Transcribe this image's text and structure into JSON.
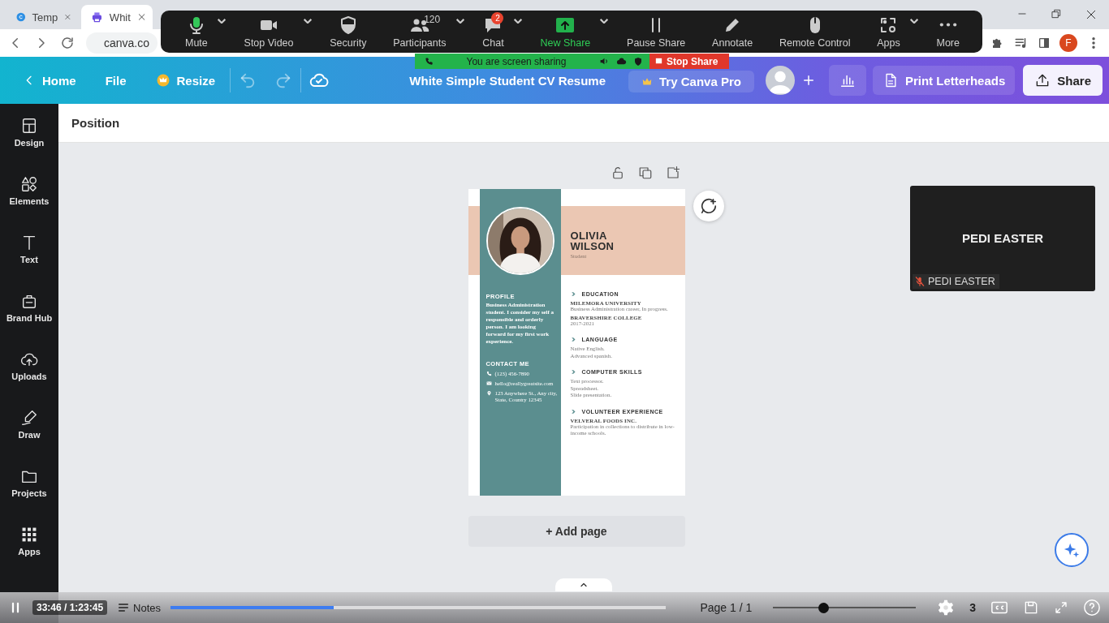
{
  "browser": {
    "tabs": [
      {
        "title": "Temp",
        "selected": false
      },
      {
        "title": "Whit",
        "selected": true
      }
    ],
    "address": "canva.co",
    "profile_initial": "F"
  },
  "zoom_toolbar": {
    "items": [
      {
        "label": "Mute",
        "has_menu": true,
        "highlighted": false
      },
      {
        "label": "Stop Video",
        "has_menu": true,
        "highlighted": false
      },
      {
        "label": "Security",
        "has_menu": false,
        "highlighted": false
      },
      {
        "label": "Participants",
        "has_menu": true,
        "highlighted": false,
        "count": "120"
      },
      {
        "label": "Chat",
        "has_menu": true,
        "highlighted": false,
        "badge": "2"
      },
      {
        "label": "New Share",
        "has_menu": true,
        "highlighted": true
      },
      {
        "label": "Pause Share",
        "has_menu": false,
        "highlighted": false
      },
      {
        "label": "Annotate",
        "has_menu": false,
        "highlighted": false
      },
      {
        "label": "Remote Control",
        "has_menu": false,
        "highlighted": false
      },
      {
        "label": "Apps",
        "has_menu": true,
        "highlighted": false
      },
      {
        "label": "More",
        "has_menu": false,
        "highlighted": false
      }
    ]
  },
  "share_banner": {
    "status": "You are screen sharing",
    "stop_label": "Stop Share"
  },
  "header": {
    "back": "Home",
    "file": "File",
    "resize": "Resize",
    "title": "White Simple Student CV Resume",
    "pro": "Try Canva Pro",
    "print": "Print Letterheads",
    "share": "Share"
  },
  "toolbar": {
    "label": "Position"
  },
  "sidebar": {
    "items": [
      {
        "label": "Design"
      },
      {
        "label": "Elements"
      },
      {
        "label": "Text"
      },
      {
        "label": "Brand Hub"
      },
      {
        "label": "Uploads"
      },
      {
        "label": "Draw"
      },
      {
        "label": "Projects"
      },
      {
        "label": "Apps"
      }
    ]
  },
  "resume": {
    "name": "OLIVIA WILSON",
    "role": "Student",
    "profile": {
      "heading": "PROFILE",
      "text": "Business Administration student. I consider my self a responsible and orderly person. I am looking forward for my first work experience."
    },
    "contact": {
      "heading": "CONTACT ME",
      "items": [
        {
          "kind": "phone",
          "text": "(123) 456-7890"
        },
        {
          "kind": "email",
          "text": "hello@reallygreatsite.com"
        },
        {
          "kind": "address",
          "text": "123 Anywhere St., Any city, State, Country 12345"
        }
      ]
    },
    "sections": [
      {
        "heading": "EDUCATION",
        "entries": [
          {
            "kind": "title",
            "text": "MILEMORA UNIVERSITY"
          },
          {
            "kind": "line",
            "text": "Business Administration career, In progress."
          },
          {
            "kind": "title",
            "text": "BRAVERSHIRE COLLEGE"
          },
          {
            "kind": "line",
            "text": "2017-2021"
          }
        ]
      },
      {
        "heading": "LANGUAGE",
        "entries": [
          {
            "kind": "line",
            "text": "Native English."
          },
          {
            "kind": "line",
            "text": "Advanced spanish."
          }
        ]
      },
      {
        "heading": "COMPUTER SKILLS",
        "entries": [
          {
            "kind": "line",
            "text": "Text processor."
          },
          {
            "kind": "line",
            "text": "Spreadsheet."
          },
          {
            "kind": "line",
            "text": "Slide presentation."
          }
        ]
      },
      {
        "heading": "VOLUNTEER EXPERIENCE",
        "entries": [
          {
            "kind": "title",
            "text": "VELVERAL FOODS INC."
          },
          {
            "kind": "line",
            "text": "Participation in collections to distribute in low-income schools."
          }
        ]
      }
    ]
  },
  "add_page": "+ Add page",
  "video_tile": {
    "name": "PEDI EASTER",
    "caption": "PEDI EASTER",
    "muted": true
  },
  "player": {
    "time": "33:46 / 1:23:45",
    "progress": {
      "level": 0.33
    },
    "notes": "Notes",
    "page": "Page 1 / 1",
    "zoom": {
      "level": 0.35
    },
    "zoom_reading": "3"
  }
}
